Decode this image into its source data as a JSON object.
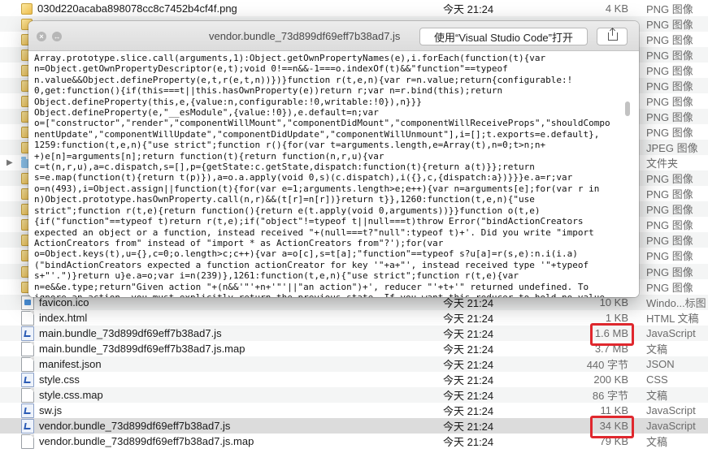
{
  "files": [
    {
      "name": "030d220acaba898078cc8c7452b4cf4f.png",
      "date": "今天 21:24",
      "size": "4 KB",
      "kind": "PNG 图像",
      "icon": "image-file-icon"
    },
    {
      "name": "",
      "date": "",
      "size": "",
      "kind": "PNG 图像",
      "icon": "image-file-icon"
    },
    {
      "name": "",
      "date": "",
      "size": "",
      "kind": "PNG 图像",
      "icon": "image-file-icon"
    },
    {
      "name": "",
      "date": "",
      "size": "",
      "kind": "PNG 图像",
      "icon": "image-file-icon"
    },
    {
      "name": "",
      "date": "",
      "size": "",
      "kind": "PNG 图像",
      "icon": "image-file-icon"
    },
    {
      "name": "",
      "date": "",
      "size": "",
      "kind": "PNG 图像",
      "icon": "image-file-icon"
    },
    {
      "name": "",
      "date": "",
      "size": "",
      "kind": "PNG 图像",
      "icon": "image-file-icon"
    },
    {
      "name": "",
      "date": "",
      "size": "",
      "kind": "PNG 图像",
      "icon": "image-file-icon"
    },
    {
      "name": "",
      "date": "",
      "size": "",
      "kind": "PNG 图像",
      "icon": "image-file-icon"
    },
    {
      "name": "",
      "date": "",
      "size": "",
      "kind": "JPEG 图像",
      "icon": "image-file-icon"
    },
    {
      "name": "",
      "date": "",
      "size": "",
      "kind": "文件夹",
      "icon": "folder-icon"
    },
    {
      "name": "",
      "date": "",
      "size": "",
      "kind": "PNG 图像",
      "icon": "image-file-icon"
    },
    {
      "name": "",
      "date": "",
      "size": "",
      "kind": "PNG 图像",
      "icon": "image-file-icon"
    },
    {
      "name": "",
      "date": "",
      "size": "",
      "kind": "PNG 图像",
      "icon": "image-file-icon"
    },
    {
      "name": "",
      "date": "",
      "size": "",
      "kind": "PNG 图像",
      "icon": "image-file-icon"
    },
    {
      "name": "",
      "date": "",
      "size": "",
      "kind": "PNG 图像",
      "icon": "image-file-icon"
    },
    {
      "name": "",
      "date": "",
      "size": "",
      "kind": "PNG 图像",
      "icon": "image-file-icon"
    },
    {
      "name": "",
      "date": "",
      "size": "",
      "kind": "PNG 图像",
      "icon": "image-file-icon"
    },
    {
      "name": "",
      "date": "",
      "size": "",
      "kind": "PNG 图像",
      "icon": "image-file-icon"
    },
    {
      "name": "favicon.ico",
      "date": "今天 21:24",
      "size": "10 KB",
      "kind": "Windo...标图像",
      "icon": "favicon-file-icon"
    },
    {
      "name": "index.html",
      "date": "今天 21:24",
      "size": "1 KB",
      "kind": "HTML 文稿",
      "icon": "document-file-icon"
    },
    {
      "name": "main.bundle_73d899df69eff7b38ad7.js",
      "date": "今天 21:24",
      "size": "1.6 MB",
      "kind": "JavaScript",
      "icon": "javascript-file-icon"
    },
    {
      "name": "main.bundle_73d899df69eff7b38ad7.js.map",
      "date": "今天 21:24",
      "size": "3.7 MB",
      "kind": "文稿",
      "icon": "document-file-icon"
    },
    {
      "name": "manifest.json",
      "date": "今天 21:24",
      "size": "440 字节",
      "kind": "JSON",
      "icon": "document-file-icon"
    },
    {
      "name": "style.css",
      "date": "今天 21:24",
      "size": "200 KB",
      "kind": "CSS",
      "icon": "javascript-file-icon"
    },
    {
      "name": "style.css.map",
      "date": "今天 21:24",
      "size": "86 字节",
      "kind": "文稿",
      "icon": "document-file-icon"
    },
    {
      "name": "sw.js",
      "date": "今天 21:24",
      "size": "11 KB",
      "kind": "JavaScript",
      "icon": "javascript-file-icon"
    },
    {
      "name": "vendor.bundle_73d899df69eff7b38ad7.js",
      "date": "今天 21:24",
      "size": "34 KB",
      "kind": "JavaScript",
      "icon": "javascript-file-icon"
    },
    {
      "name": "vendor.bundle_73d899df69eff7b38ad7.js.map",
      "date": "今天 21:24",
      "size": "79 KB",
      "kind": "文稿",
      "icon": "document-file-icon"
    }
  ],
  "quicklook": {
    "title": "vendor.bundle_73d899df69eff7b38ad7.js",
    "open_with_label": "使用“Visual Studio Code”打开",
    "code_lines": [
      "Array.prototype.slice.call(arguments,1):Object.getOwnPropertyNames(e),i.forEach(function(t){var",
      "n=Object.getOwnPropertyDescriptor(e,t);void 0!==n&&-1===o.indexOf(t)&&\"function\"==typeof",
      "n.value&&Object.defineProperty(e,t,r(e,t,n))})}function r(t,e,n){var r=n.value;return{configurable:!",
      "0,get:function(){if(this===t||this.hasOwnProperty(e))return r;var n=r.bind(this);return",
      "Object.defineProperty(this,e,{value:n,configurable:!0,writable:!0}),n}}}",
      "Object.defineProperty(e,\"__esModule\",{value:!0}),e.default=n;var",
      "o=[\"constructor\",\"render\",\"componentWillMount\",\"componentDidMount\",\"componentWillReceiveProps\",\"shouldCompo",
      "nentUpdate\",\"componentWillUpdate\",\"componentDidUpdate\",\"componentWillUnmount\"],i=[];t.exports=e.default},",
      "1259:function(t,e,n){\"use strict\";function r(){for(var t=arguments.length,e=Array(t),n=0;t>n;n+",
      "+)e[n]=arguments[n];return function(t){return function(n,r,u){var",
      "c=t(n,r,u),a=c.dispatch,s=[],p={getState:c.getState,dispatch:function(t){return a(t)}};return",
      "s=e.map(function(t){return t(p)}),a=o.a.apply(void 0,s)(c.dispatch),i({},c,{dispatch:a})}}}e.a=r;var",
      "o=n(493),i=Object.assign||function(t){for(var e=1;arguments.length>e;e++){var n=arguments[e];for(var r in",
      "n)Object.prototype.hasOwnProperty.call(n,r)&&(t[r]=n[r])}return t}},1260:function(t,e,n){\"use",
      "strict\";function r(t,e){return function(){return e(t.apply(void 0,arguments))}}function o(t,e)",
      "{if(\"function\"==typeof t)return r(t,e);if(\"object\"!=typeof t||null===t)throw Error(\"bindActionCreators",
      "expected an object or a function, instead received \"+(null===t?\"null\":typeof t)+'. Did you write \"import",
      "ActionCreators from\" instead of \"import * as ActionCreators from\"?');for(var",
      "o=Object.keys(t),u={},c=0;o.length>c;c++){var a=o[c],s=t[a];\"function\"==typeof s?u[a]=r(s,e):n.i(i.a)",
      "(\"bindActionCreators expected a function actionCreator for key '\"+a+\"', instead received type '\"+typeof",
      "s+\"'.\")}return u}e.a=o;var i=n(239)},1261:function(t,e,n){\"use strict\";function r(t,e){var",
      "n=e&&e.type;return\"Given action \"+(n&&'\"'+n+'\"'||\"an action\")+', reducer \"'+t+'\" returned undefined. To",
      "ignore an action, you must explicitly return the previous state. If you want this reducer to hold no value,"
    ]
  },
  "colors": {
    "highlight_box": "#e0282e",
    "selected_row": "#dcdcdc"
  }
}
